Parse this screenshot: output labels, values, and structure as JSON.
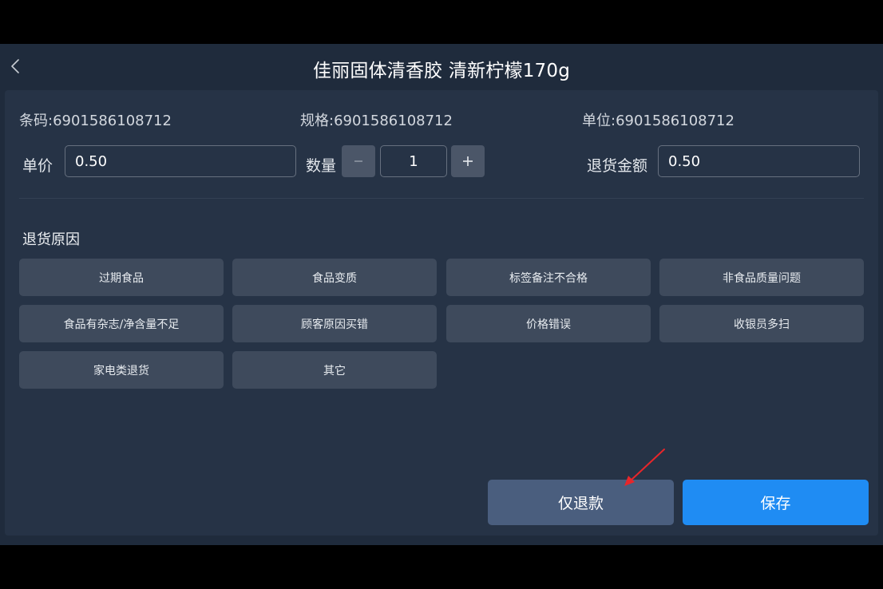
{
  "header": {
    "title": "佳丽固体清香胶 清新柠檬170g",
    "back_icon": "chevron-left-icon"
  },
  "product": {
    "barcode_label": "条码:",
    "barcode_value": "6901586108712",
    "spec_label": "规格:",
    "spec_value": "6901586108712",
    "unit_label": "单位:",
    "unit_value": "6901586108712"
  },
  "form": {
    "price_label": "单价",
    "price_value": "0.50",
    "quantity_label": "数量",
    "quantity_value": "1",
    "refund_amount_label": "退货金额",
    "refund_amount_value": "0.50"
  },
  "reasons": {
    "title": "退货原因",
    "items": [
      {
        "label": "过期食品"
      },
      {
        "label": "食品变质"
      },
      {
        "label": "标签备注不合格"
      },
      {
        "label": "非食品质量问题"
      },
      {
        "label": "食品有杂志/净含量不足"
      },
      {
        "label": "顾客原因买错"
      },
      {
        "label": "价格错误"
      },
      {
        "label": "收银员多扫"
      },
      {
        "label": "家电类退货"
      },
      {
        "label": "其它"
      }
    ]
  },
  "actions": {
    "refund_only_label": "仅退款",
    "save_label": "保存"
  },
  "colors": {
    "background": "#1f2b3c",
    "panel": "#263346",
    "reason_button": "#3e4a5c",
    "refund_button": "#4a5e7e",
    "save_button": "#1f8cf3",
    "annotation_arrow": "#e8262a"
  }
}
